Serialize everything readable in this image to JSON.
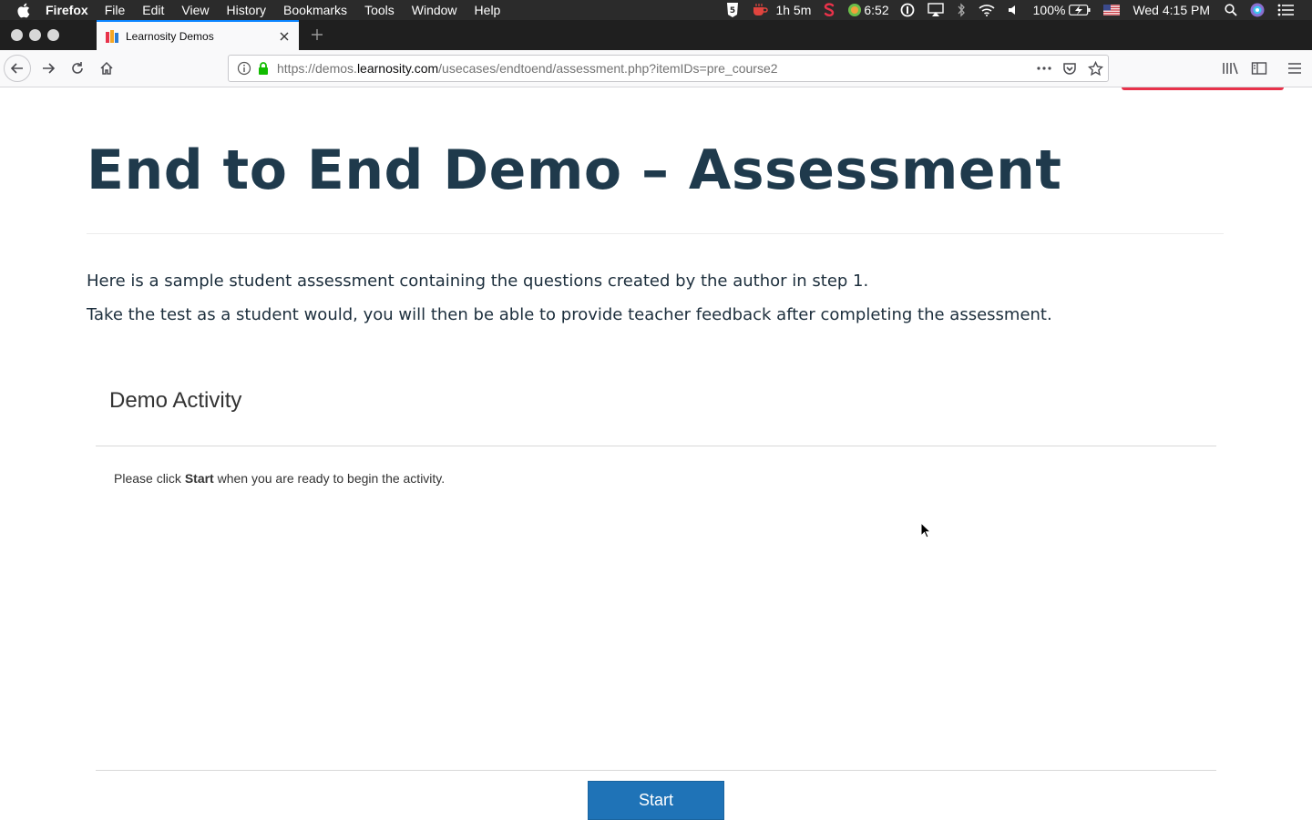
{
  "menubar": {
    "app": "Firefox",
    "items": [
      "File",
      "Edit",
      "View",
      "History",
      "Bookmarks",
      "Tools",
      "Window",
      "Help"
    ],
    "status": {
      "timer": "1h 5m",
      "clock_badge": "6:52",
      "battery": "100%",
      "datetime": "Wed 4:15 PM"
    }
  },
  "tab": {
    "title": "Learnosity Demos"
  },
  "navbar": {
    "url_prefix": "https://demos.",
    "url_domain": "learnosity.com",
    "url_path": "/usecases/endtoend/assessment.php?itemIDs=pre_course2"
  },
  "page": {
    "title": "End to End Demo – Assessment",
    "para1": "Here is a sample student assessment containing the questions created by the author in step 1.",
    "para2": "Take the test as a student would, you will then be able to provide teacher feedback after completing the assessment.",
    "activity": {
      "title": "Demo Activity",
      "instruction_pre": "Please click ",
      "instruction_bold": "Start",
      "instruction_post": " when you are ready to begin the activity.",
      "start_label": "Start"
    }
  },
  "colors": {
    "accent": "#1f73b7",
    "title": "#1f3a4c",
    "tab_highlight": "#0a84ff"
  }
}
